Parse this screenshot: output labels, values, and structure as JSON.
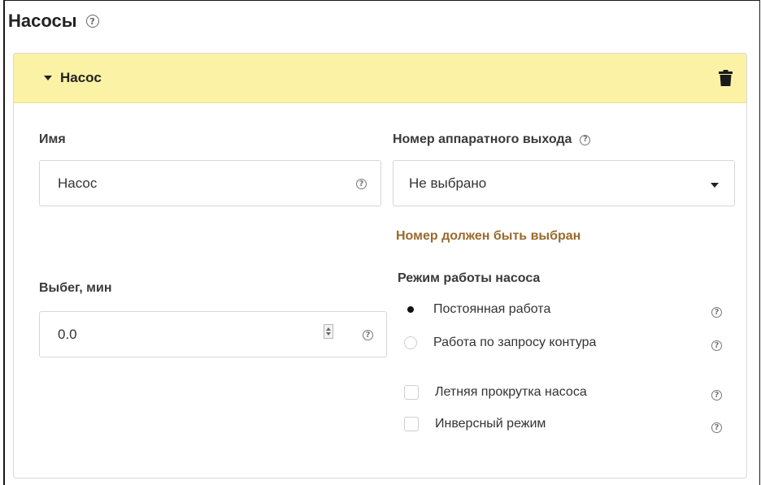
{
  "section": {
    "title": "Насосы",
    "help_icon": "question-circle-icon"
  },
  "pump": {
    "header_title": "Насос",
    "delete_icon": "trash-icon",
    "name": {
      "label": "Имя",
      "value": "Насос"
    },
    "output": {
      "label": "Номер аппаратного выхода",
      "value": "Не выбрано",
      "error": "Номер должен быть выбран"
    },
    "runout": {
      "label": "Выбег, мин",
      "value": "0.0"
    },
    "mode": {
      "label": "Режим работы насоса",
      "options": [
        {
          "label": "Постоянная работа",
          "selected": true
        },
        {
          "label": "Работа по запросу контура",
          "selected": false
        }
      ]
    },
    "checkboxes": [
      {
        "label": "Летняя прокрутка насоса",
        "checked": false
      },
      {
        "label": "Инверсный режим",
        "checked": false
      }
    ]
  },
  "colors": {
    "header_bg": "#fbf2a5",
    "error_text": "#9a6a2c"
  }
}
